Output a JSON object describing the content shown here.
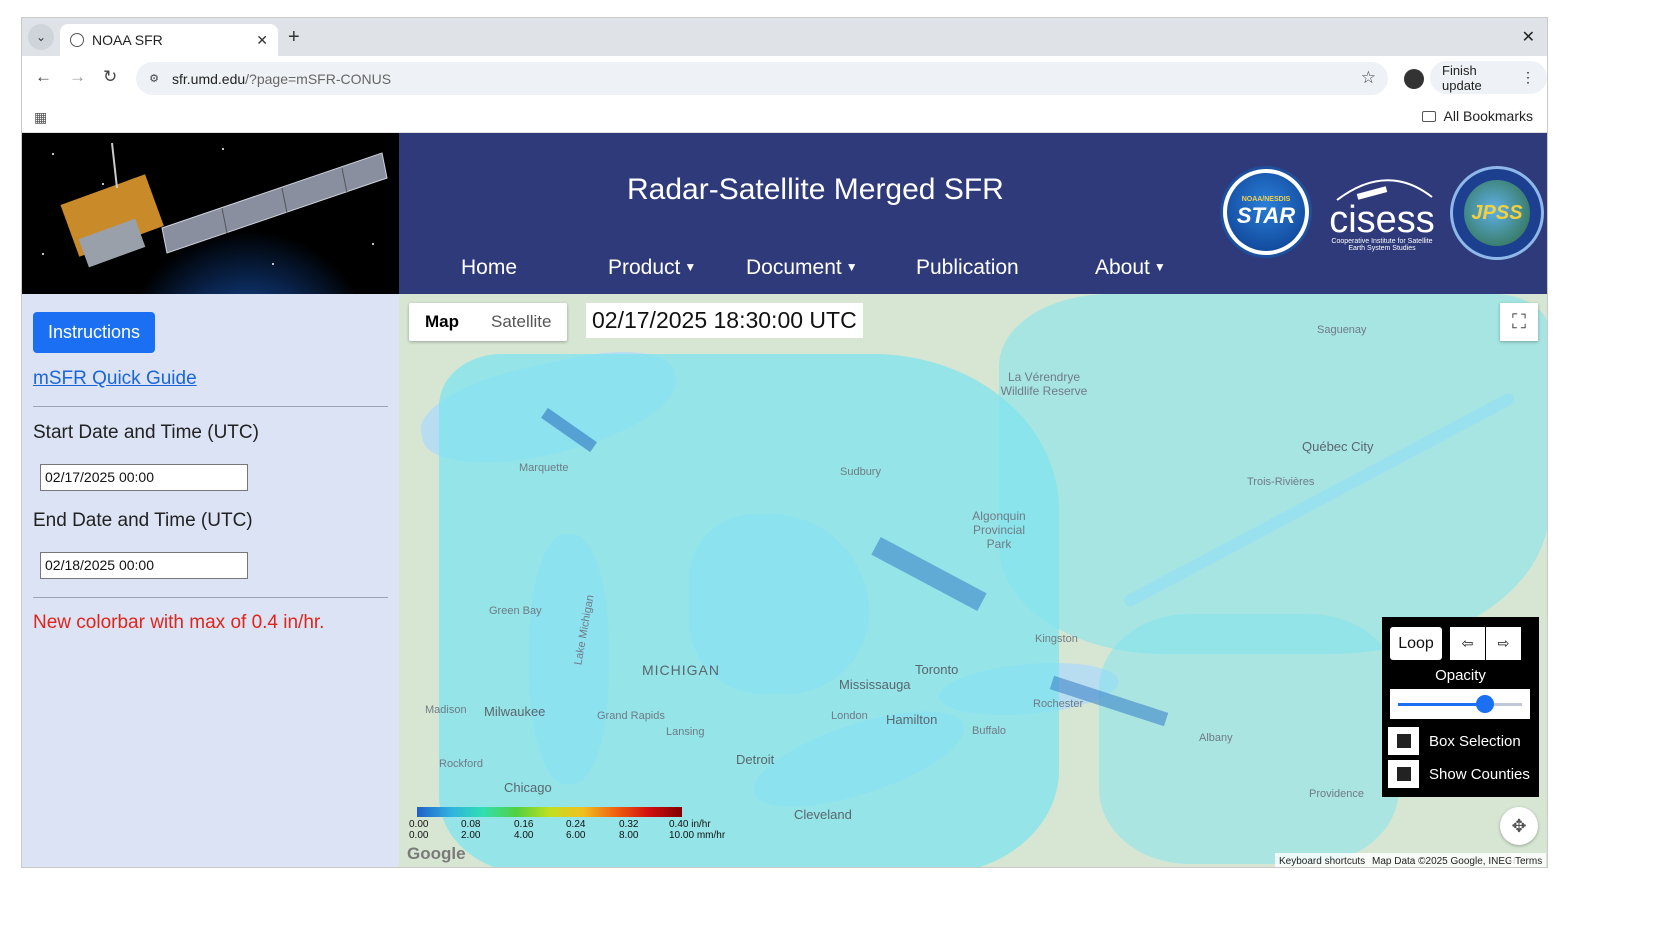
{
  "browser": {
    "tab_title": "NOAA SFR",
    "url_host": "sfr.umd.edu",
    "url_path": "/?page=mSFR-CONUS",
    "update_label": "Finish update",
    "bookmarks_label": "All Bookmarks"
  },
  "header": {
    "title": "Radar-Satellite Merged SFR",
    "nav": [
      "Home",
      "Product",
      "Document",
      "Publication",
      "About"
    ],
    "logos": {
      "star": "STAR",
      "star_ring": "NOAA/NESDIS",
      "cisess": "cisess",
      "cisess_sub1": "Cooperative Institute for Satellite",
      "cisess_sub2": "Earth System Studies",
      "jpss": "JPSS"
    }
  },
  "sidebar": {
    "instructions_label": "Instructions",
    "quick_guide": "mSFR Quick Guide",
    "start_label": "Start Date and Time (UTC)",
    "start_value": "02/17/2025 00:00",
    "end_label": "End Date and Time (UTC)",
    "end_value": "02/18/2025 00:00",
    "notice": "New colorbar with max of 0.4 in/hr."
  },
  "map": {
    "type_map": "Map",
    "type_satellite": "Satellite",
    "timestamp": "02/17/2025 18:30:00 UTC",
    "controls": {
      "loop": "Loop",
      "prev": "⇦",
      "next": "⇨",
      "opacity": "Opacity",
      "opacity_value": 0.7,
      "box_selection": "Box Selection",
      "show_counties": "Show Counties"
    },
    "colorbar": {
      "in_hr": [
        "0.00",
        "0.08",
        "0.16",
        "0.24",
        "0.32",
        "0.40"
      ],
      "mm_hr": [
        "0.00",
        "2.00",
        "4.00",
        "6.00",
        "8.00",
        "10.00"
      ],
      "unit_in": "in/hr",
      "unit_mm": "mm/hr"
    },
    "labels": {
      "michigan": "MICHIGAN",
      "milwaukee": "Milwaukee",
      "chicago": "Chicago",
      "detroit": "Detroit",
      "toronto": "Toronto",
      "mississauga": "Mississauga",
      "hamilton": "Hamilton",
      "cleveland": "Cleveland",
      "quebec": "Québec City",
      "lake_michigan": "Lake Michigan",
      "sudbury": "Sudbury",
      "algonquin": "Algonquin Provincial Park",
      "laverendrye": "La Vérendrye Wildlife Reserve",
      "trois": "Trois-Rivières",
      "marquette": "Marquette",
      "green_bay": "Green Bay",
      "lansing": "Lansing",
      "grand_rapids": "Grand Rapids",
      "kingston": "Kingston",
      "rochester": "Rochester",
      "buffalo": "Buffalo",
      "albany": "Albany",
      "providence": "Providence",
      "saguenay": "Saguenay",
      "london": "London",
      "madison": "Madison",
      "rockford": "Rockford"
    },
    "google": "Google",
    "keyboard": "Keyboard shortcuts",
    "map_data": "Map Data ©2025 Google, INEGI",
    "terms": "Terms"
  }
}
